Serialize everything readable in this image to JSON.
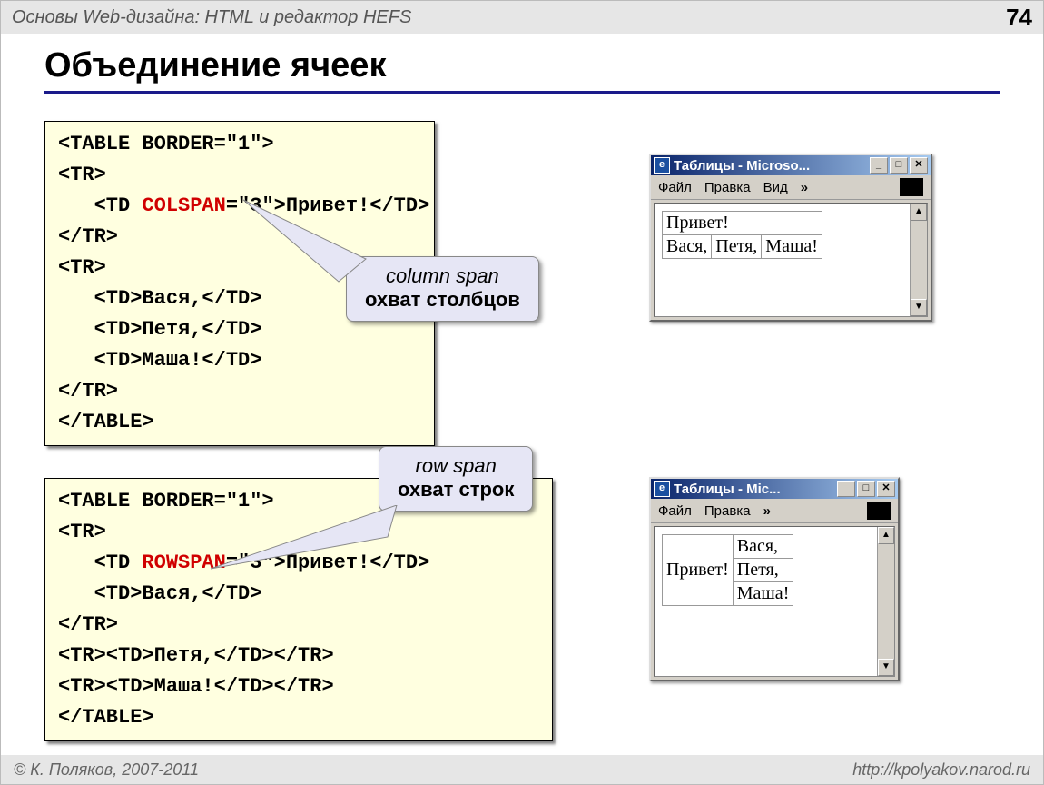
{
  "header": {
    "title": "Основы Web-дизайна: HTML и редактор HEFS",
    "page": "74"
  },
  "slide_title": "Объединение ячеек",
  "code1": {
    "l1a": "<TABLE BORDER=\"1\">",
    "l2a": "<TR>",
    "l3a": "   <TD ",
    "l3b": "COLSPAN",
    "l3c": "=\"3\">Привет!</TD>",
    "l4a": "</TR>",
    "l5a": "<TR>",
    "l6a": "   <TD>Вася,</TD>",
    "l7a": "   <TD>Петя,</TD>",
    "l8a": "   <TD>Маша!</TD>",
    "l9a": "</TR>",
    "l10a": "</TABLE>"
  },
  "callout1": {
    "it": "column span",
    "bold": "охват столбцов"
  },
  "code2": {
    "l1a": "<TABLE BORDER=\"1\">",
    "l2a": "<TR>",
    "l3a": "   <TD ",
    "l3b": "ROWSPAN",
    "l3c": "=\"3\">Привет!</TD>",
    "l4a": "   <TD>Вася,</TD>",
    "l5a": "</TR>",
    "l6a": "<TR><TD>Петя,</TD></TR>",
    "l7a": "<TR><TD>Маша!</TD></TR>",
    "l8a": "</TABLE>"
  },
  "callout2": {
    "it": "row span",
    "bold": "охват строк"
  },
  "win1": {
    "title": "Таблицы - Microso...",
    "menu": [
      "Файл",
      "Правка",
      "Вид"
    ],
    "chev": "»",
    "table": {
      "r1c1": "Привет!",
      "r2c1": "Вася,",
      "r2c2": "Петя,",
      "r2c3": "Маша!"
    }
  },
  "win2": {
    "title": "Таблицы - Mic...",
    "menu": [
      "Файл",
      "Правка"
    ],
    "chev": "»",
    "table": {
      "c1": "Привет!",
      "r1": "Вася,",
      "r2": "Петя,",
      "r3": "Маша!"
    }
  },
  "winbtns": {
    "min": "_",
    "max": "□",
    "close": "✕"
  },
  "scroll": {
    "up": "▲",
    "down": "▼"
  },
  "footer": {
    "left": "© К. Поляков, 2007-2011",
    "right": "http://kpolyakov.narod.ru"
  }
}
